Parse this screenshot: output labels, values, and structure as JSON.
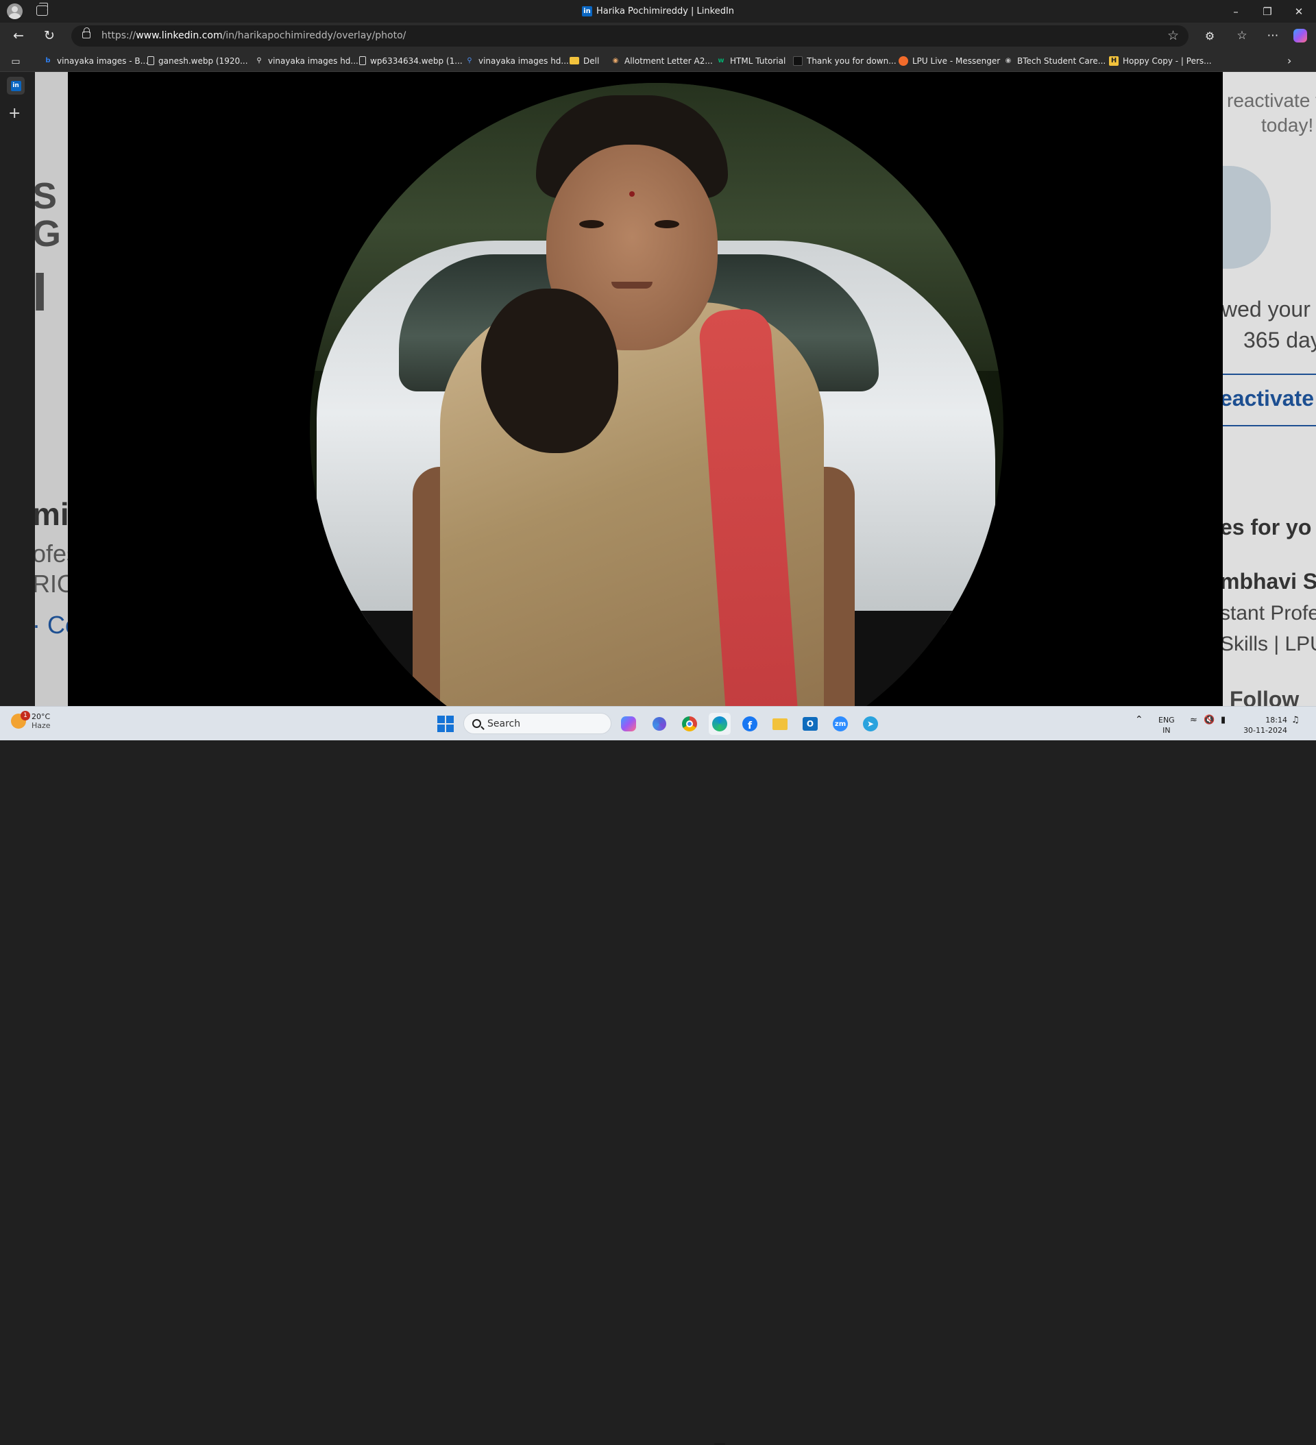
{
  "window": {
    "title": "Harika Pochimireddy | LinkedIn",
    "controls": [
      "minimize",
      "restore",
      "close"
    ]
  },
  "address_bar": {
    "url_prefix": "https://",
    "url_domain": "www.linkedin.com",
    "url_path": "/in/harikapochimireddy/overlay/photo/"
  },
  "bookmarks": [
    {
      "label": "vinayaka images - B...",
      "icon": "bing-icon",
      "color": "#2f7ff0"
    },
    {
      "label": "ganesh.webp (1920...",
      "icon": "file-icon",
      "color": "#e8e8e8"
    },
    {
      "label": "vinayaka images hd...",
      "icon": "search-icon",
      "color": "#e8e8e8"
    },
    {
      "label": "wp6334634.webp (1...",
      "icon": "file-icon",
      "color": "#e8e8e8"
    },
    {
      "label": "vinayaka images hd...",
      "icon": "search-icon",
      "color": "#4e8ff0"
    },
    {
      "label": "Dell",
      "icon": "folder-icon",
      "color": "#f2c23c"
    },
    {
      "label": "Allotment Letter A2...",
      "icon": "globe-icon",
      "color": "#e8a86a"
    },
    {
      "label": "HTML Tutorial",
      "icon": "w3-icon",
      "color": "#04aa6d"
    },
    {
      "label": "Thank you for down...",
      "icon": "page-icon",
      "color": "#1a1a1a"
    },
    {
      "label": "LPU Live - Messenger",
      "icon": "chat-icon",
      "color": "#f26b2b"
    },
    {
      "label": "BTech Student Care...",
      "icon": "globe-icon",
      "color": "#bbbbbb"
    },
    {
      "label": "Hoppy Copy - | Pers...",
      "icon": "h-icon",
      "color": "#f2c23c"
    }
  ],
  "background_page": {
    "left_fragments": [
      "S",
      "G",
      "I",
      "mi",
      "ofes",
      "RIO",
      "· Co"
    ],
    "right_fragments": [
      "reactivate y",
      "today!",
      "wed your",
      "365 day",
      "eactivate",
      "es for yo",
      "mbhavi S",
      "stant Profe",
      "Skills | LPU",
      "Follow"
    ]
  },
  "taskbar": {
    "weather": {
      "temp": "20°C",
      "desc": "Haze",
      "badge": "1"
    },
    "search_placeholder": "Search",
    "apps": [
      "windows-start-icon",
      "copilot-icon",
      "photos-icon",
      "chrome-icon",
      "edge-icon",
      "facebook-icon",
      "file-explorer-icon",
      "outlook-icon",
      "zoom-icon",
      "telegram-icon"
    ],
    "language": {
      "line1": "ENG",
      "line2": "IN"
    },
    "time": "18:14",
    "date": "30-11-2024"
  },
  "colors": {
    "linkedin_blue": "#0a66c2",
    "browser_dark": "#202020",
    "taskbar": "#dde3ea"
  }
}
